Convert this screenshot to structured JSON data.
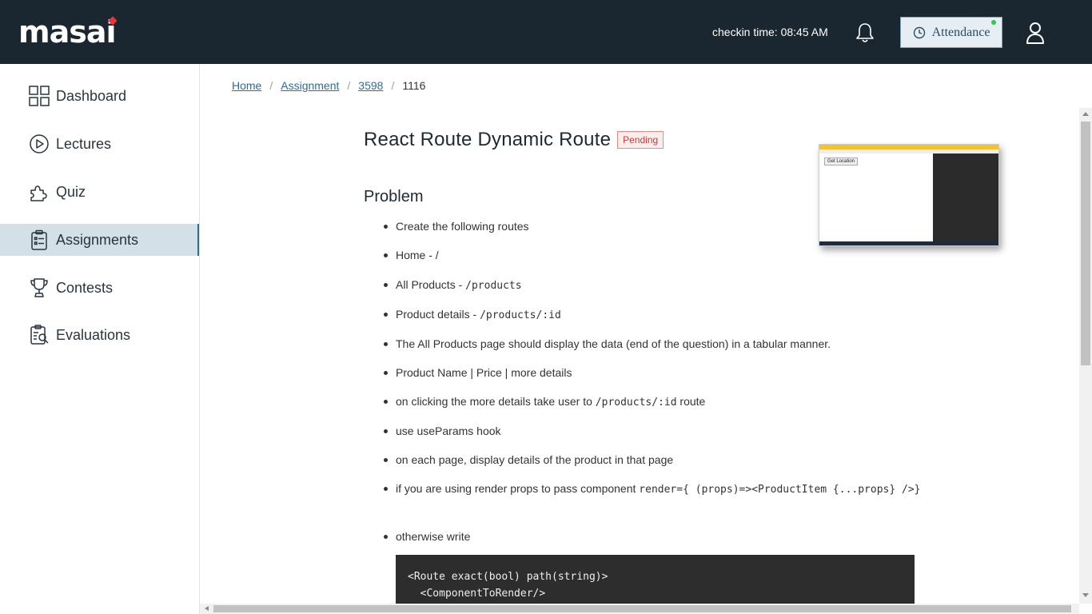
{
  "app": {
    "logo": "masai",
    "checkin": "checkin time: 08:45 AM",
    "attendance_label": "Attendance"
  },
  "sidebar": {
    "items": [
      {
        "label": "Dashboard",
        "icon": "grid-icon",
        "active": false
      },
      {
        "label": "Lectures",
        "icon": "play-circle-icon",
        "active": false
      },
      {
        "label": "Quiz",
        "icon": "puzzle-icon",
        "active": false
      },
      {
        "label": "Assignments",
        "icon": "clipboard-icon",
        "active": true
      },
      {
        "label": "Contests",
        "icon": "trophy-icon",
        "active": false
      },
      {
        "label": "Evaluations",
        "icon": "evaluation-icon",
        "active": false
      }
    ]
  },
  "breadcrumb": {
    "home": "Home",
    "assignment": "Assignment",
    "id": "3598",
    "current": "1116",
    "separator": "/"
  },
  "assignment": {
    "title": "React Route Dynamic Route",
    "status": "Pending",
    "thumbnail_button": "Get Location",
    "problem_heading": "Problem",
    "items": [
      {
        "text": "Create the following routes",
        "code": ""
      },
      {
        "text": "Home - /",
        "code": ""
      },
      {
        "text": "All Products - ",
        "code": "/products"
      },
      {
        "text": "Product details - ",
        "code": "/products/:id"
      },
      {
        "text": "The All Products page should display the data (end of the question) in a tabular manner.",
        "code": ""
      },
      {
        "text": "Product Name | Price | more details",
        "code": ""
      },
      {
        "text": "on clicking the more details take user to ",
        "code": "/products/:id",
        "suffix": " route"
      },
      {
        "text": "use useParams hook",
        "code": ""
      },
      {
        "text": "on each page, display details of the product in that page",
        "code": ""
      },
      {
        "text": "if you are using render props to pass component ",
        "code": "render={ (props)=><ProductItem {...props} />}"
      },
      {
        "text": "otherwise write",
        "code": ""
      }
    ],
    "code_block": "<Route exact(bool) path(string)>\n  <ComponentToRender/>"
  },
  "colors": {
    "topbar": "#1a2630",
    "accent_red": "#e8343d",
    "active_sidebar": "#d3e0e7",
    "link": "#2b6d9a"
  }
}
